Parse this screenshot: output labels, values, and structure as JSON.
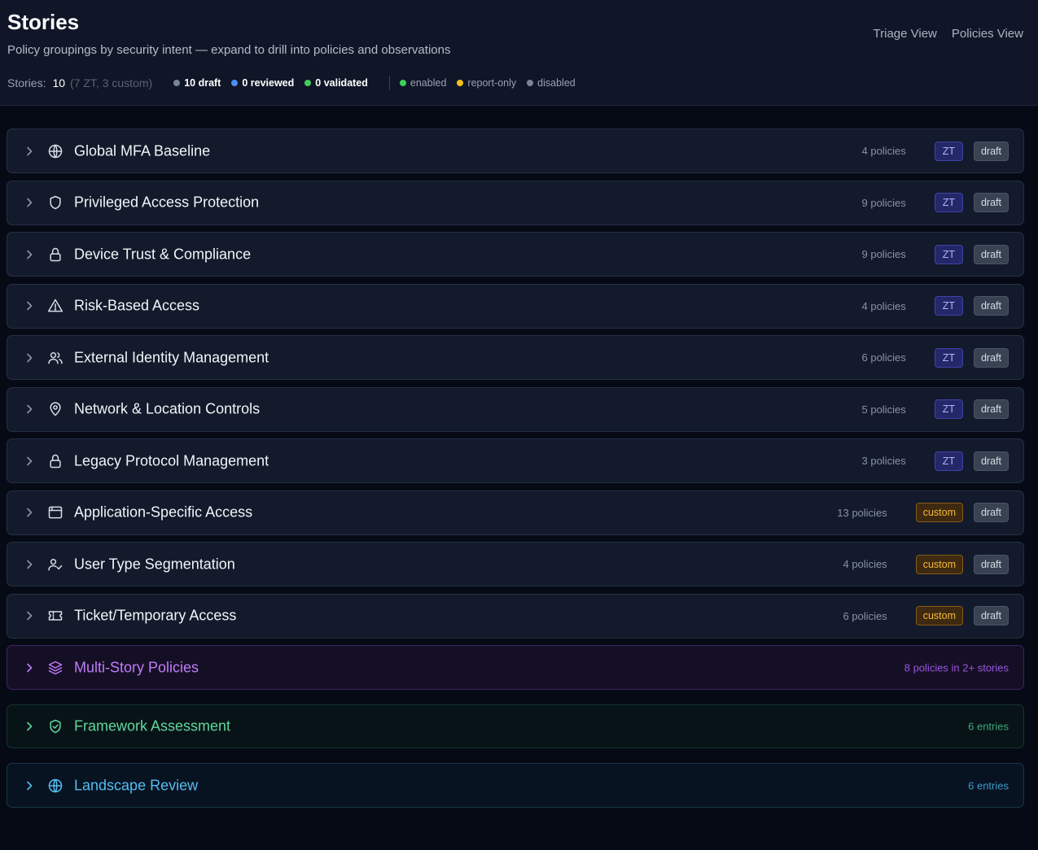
{
  "header": {
    "title": "Stories",
    "subtitle": "Policy groupings by security intent — expand to drill into policies and observations",
    "views": [
      "Triage View",
      "Policies View"
    ],
    "stats": {
      "label": "Stories:",
      "count": "10",
      "breakdown": "(7 ZT, 3 custom)",
      "review": [
        {
          "label": "10 draft",
          "color": "#7c8594"
        },
        {
          "label": "0 reviewed",
          "color": "#4d8ef7"
        },
        {
          "label": "0 validated",
          "color": "#3fcf5a"
        }
      ],
      "state": [
        {
          "label": "enabled",
          "color": "#3fcf5a"
        },
        {
          "label": "report-only",
          "color": "#f2c01c"
        },
        {
          "label": "disabled",
          "color": "#7c8594"
        }
      ]
    }
  },
  "stories": [
    {
      "title": "Global MFA Baseline",
      "icon": "globe-icon",
      "count": "4 policies",
      "type": "ZT",
      "type_class": "zt",
      "status": "draft"
    },
    {
      "title": "Privileged Access Protection",
      "icon": "shield-icon",
      "count": "9 policies",
      "type": "ZT",
      "type_class": "zt",
      "status": "draft"
    },
    {
      "title": "Device Trust & Compliance",
      "icon": "lock-icon",
      "count": "9 policies",
      "type": "ZT",
      "type_class": "zt",
      "status": "draft"
    },
    {
      "title": "Risk-Based Access",
      "icon": "warning-icon",
      "count": "4 policies",
      "type": "ZT",
      "type_class": "zt",
      "status": "draft"
    },
    {
      "title": "External Identity Management",
      "icon": "users-icon",
      "count": "6 policies",
      "type": "ZT",
      "type_class": "zt",
      "status": "draft"
    },
    {
      "title": "Network & Location Controls",
      "icon": "location-pin-icon",
      "count": "5 policies",
      "type": "ZT",
      "type_class": "zt",
      "status": "draft"
    },
    {
      "title": "Legacy Protocol Management",
      "icon": "lock-icon",
      "count": "3 policies",
      "type": "ZT",
      "type_class": "zt",
      "status": "draft"
    },
    {
      "title": "Application-Specific Access",
      "icon": "app-window-icon",
      "count": "13 policies",
      "type": "custom",
      "type_class": "custom",
      "status": "draft"
    },
    {
      "title": "User Type Segmentation",
      "icon": "user-check-icon",
      "count": "4 policies",
      "type": "custom",
      "type_class": "custom",
      "status": "draft"
    },
    {
      "title": "Ticket/Temporary Access",
      "icon": "ticket-icon",
      "count": "6 policies",
      "type": "custom",
      "type_class": "custom",
      "status": "draft"
    }
  ],
  "sections": [
    {
      "title": "Multi-Story Policies",
      "icon": "layers-icon",
      "count": "8 policies in 2+ stories",
      "color": "#c07cf8"
    },
    {
      "title": "Framework Assessment",
      "icon": "shield-check-icon",
      "count": "6 entries",
      "color": "#5fd79a"
    },
    {
      "title": "Landscape Review",
      "icon": "globe-icon",
      "count": "6 entries",
      "color": "#55bdf0"
    }
  ]
}
